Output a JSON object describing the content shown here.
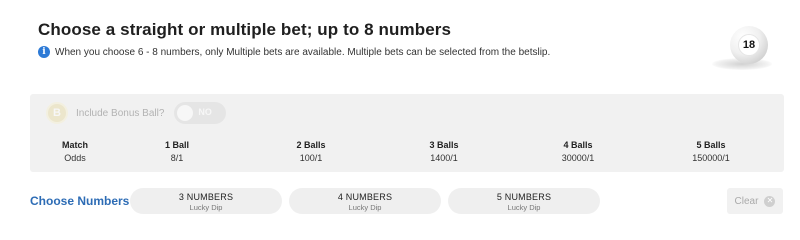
{
  "header": {
    "title": "Choose a straight or multiple bet; up to 8 numbers",
    "info_icon": "i",
    "info_text": "When you choose 6 - 8 numbers, only Multiple bets are available. Multiple bets can be selected from the betslip."
  },
  "ball": {
    "number": "18"
  },
  "bonus": {
    "badge": "B",
    "label": "Include Bonus Ball?",
    "toggle_text": "NO",
    "enabled": false
  },
  "odds": {
    "columns": [
      {
        "head": "Match",
        "value": "Odds"
      },
      {
        "head": "1 Ball",
        "value": "8/1"
      },
      {
        "head": "2 Balls",
        "value": "100/1"
      },
      {
        "head": "3 Balls",
        "value": "1400/1"
      },
      {
        "head": "4 Balls",
        "value": "30000/1"
      },
      {
        "head": "5 Balls",
        "value": "150000/1"
      }
    ]
  },
  "choose": {
    "label": "Choose Numbers",
    "lucky_dips": [
      {
        "label": "3 NUMBERS",
        "sub": "Lucky Dip"
      },
      {
        "label": "4 NUMBERS",
        "sub": "Lucky Dip"
      },
      {
        "label": "5 NUMBERS",
        "sub": "Lucky Dip"
      }
    ]
  },
  "clear": {
    "label": "Clear",
    "icon": "close-icon"
  },
  "colors": {
    "accent": "#2d6cb5",
    "info": "#2d7ad6",
    "panel": "#f1f1f1"
  }
}
